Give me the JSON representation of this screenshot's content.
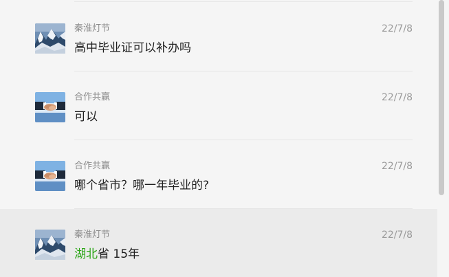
{
  "messages": [
    {
      "sender": "秦淮灯节",
      "time": "22/7/8",
      "avatar_icon": "snowy-mountain-avatar",
      "text": "高中毕业证可以补办吗"
    },
    {
      "sender": "合作共赢",
      "time": "22/7/8",
      "avatar_icon": "handshake-avatar",
      "text": "可以"
    },
    {
      "sender": "合作共赢",
      "time": "22/7/8",
      "avatar_icon": "handshake-avatar",
      "text": "哪个省市？哪一年毕业的?"
    },
    {
      "sender": "秦淮灯节",
      "time": "22/7/8",
      "avatar_icon": "snowy-mountain-avatar",
      "text_link": "湖北",
      "text_rest": "省 15年"
    }
  ],
  "colors": {
    "background": "#f5f5f5",
    "highlight_row": "#ebebeb",
    "link_green": "#2aa515",
    "meta_gray": "#8b8b8b"
  }
}
